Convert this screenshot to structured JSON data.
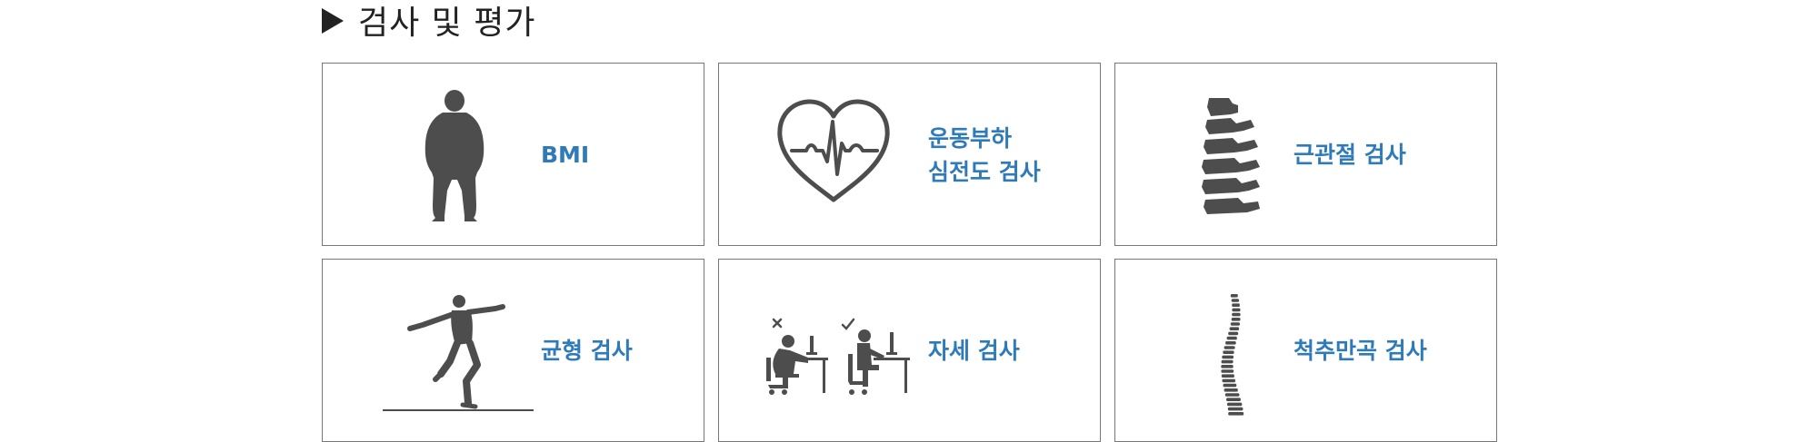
{
  "section": {
    "title": "검사 및 평가"
  },
  "cards": [
    {
      "label_lines": [
        "BMI"
      ],
      "icon": "body-silhouette-icon"
    },
    {
      "label_lines": [
        "운동부하",
        "심전도 검사"
      ],
      "icon": "heart-ecg-icon"
    },
    {
      "label_lines": [
        "근관절 검사"
      ],
      "icon": "vertebrae-icon"
    },
    {
      "label_lines": [
        "균형 검사"
      ],
      "icon": "balance-person-icon"
    },
    {
      "label_lines": [
        "자세 검사"
      ],
      "icon": "posture-desk-icon"
    },
    {
      "label_lines": [
        "척추만곡 검사"
      ],
      "icon": "spine-curve-icon"
    }
  ],
  "colors": {
    "label": "#2f7ab9",
    "icon": "#4d4d4d",
    "border": "#777777",
    "heading": "#222222"
  }
}
